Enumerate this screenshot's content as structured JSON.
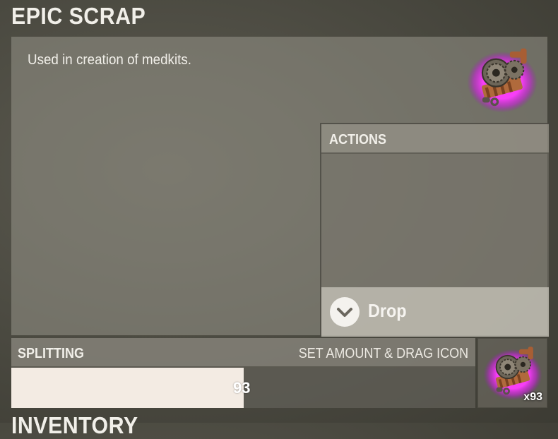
{
  "item": {
    "title": "EPIC SCRAP",
    "description": "Used in creation of medkits.",
    "icon": "scrap-gears-icon",
    "glow_color": "#e040fb"
  },
  "actions": {
    "title": "ACTIONS",
    "drop": {
      "label": "Drop",
      "icon": "chevron-down-icon"
    }
  },
  "splitting": {
    "title": "SPLITTING",
    "hint": "SET AMOUNT & DRAG ICON",
    "value": "93",
    "fill_fraction": 0.5
  },
  "slot": {
    "count": "x93"
  },
  "inventory": {
    "title": "INVENTORY"
  },
  "colors": {
    "accent_glow": "#e040fb",
    "slider_fill": "#f3ebe3"
  }
}
